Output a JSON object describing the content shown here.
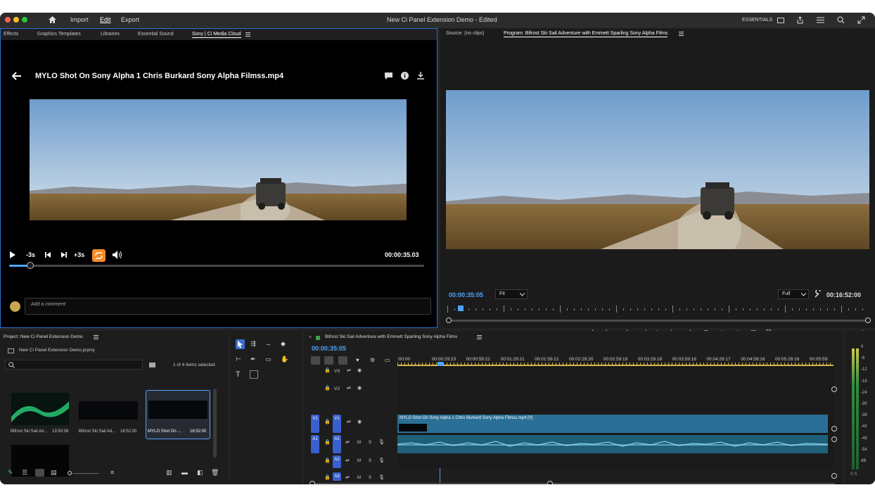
{
  "menubar": {
    "import": "Import",
    "edit": "Edit",
    "export": "Export",
    "doc_title": "New Ci Panel Extension Demo - Edited",
    "workspace": "ESSENTIALS"
  },
  "left_tabs": [
    "Effects",
    "Graphics Templates",
    "Libraries",
    "Essential Sound",
    "Sony | Ci Media Cloud"
  ],
  "ci_panel": {
    "clip_title": "MYLO Shot On Sony Alpha 1 Chris Burkard Sony Alpha Filmss.mp4",
    "back_label": "-3s",
    "forward_label": "+3s",
    "timecode": "00:00:35.03",
    "comment_placeholder": "Add a comment",
    "scrub_progress": 0.05
  },
  "monitor": {
    "source_tab": "Source: (no clips)",
    "program_tab": "Program: Bifrost Ski Sail Adventure with Emmett Sparling  Sony Alpha Films",
    "timecode": "00:00:35:05",
    "fit_value": "Fit",
    "quality_value": "Full",
    "duration": "00:16:52:00"
  },
  "project": {
    "title": "Project: New Ci Panel Extension Demo",
    "file": "New Ci Panel Extension Demo.prproj",
    "selection_info": "1 of 4 items selected",
    "items": [
      {
        "name": "Bifrost Ski Sail Ad...",
        "duration": "13:50:06"
      },
      {
        "name": "Bifrost Ski Sail Ad...",
        "duration": "16:52:00"
      },
      {
        "name": "MYLO  Shot On ...",
        "duration": "16:52:00"
      },
      {
        "name": "",
        "duration": ""
      }
    ]
  },
  "timeline": {
    "sequence_name": "Bifrost Ski Sail Adventure with Emmett Sparling  Sony Alpha Films",
    "timecode": "00:00:35:05",
    "ruler": [
      ":00:00",
      "00:00:29:23",
      "00:00:59:22",
      "00:01:29:21",
      "00:01:59:21",
      "00:02:29:20",
      "00:02:59:19",
      "00:03:29:18",
      "00:03:59:18",
      "00:04:29:17",
      "00:04:59:16",
      "00:05:29:16",
      "00:05:59:"
    ],
    "tracks": {
      "v3": "V3",
      "v2": "V2",
      "v1": "V1",
      "a1": "A1",
      "a2": "A2",
      "a3": "A3",
      "mute": "M",
      "solo": "S"
    },
    "clip_label": "MYLO  Shot On Sony Alpha 1  Chris Burkard  Sony Alpha Filmss.mp4 [V]"
  },
  "meter": {
    "scale": [
      "0",
      "-6",
      "-12",
      "-18",
      "-24",
      "-30",
      "-36",
      "-42",
      "-48",
      "-54",
      "dB"
    ],
    "footer": "S S"
  },
  "colors": {
    "accent": "#4da3ff",
    "track_blue": "#3a5fcf",
    "clip": "#2a6f95",
    "audio": "#1f5f7a",
    "orange": "#f28c28"
  }
}
